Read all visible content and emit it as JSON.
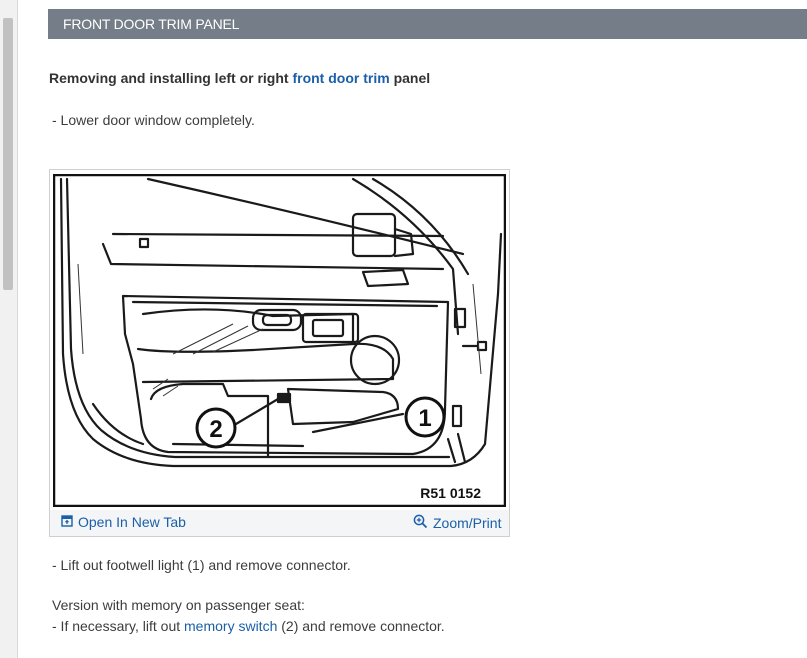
{
  "header": {
    "title": "FRONT DOOR TRIM PANEL"
  },
  "intro": {
    "prefix": "Removing and installing left or right ",
    "link": "front door trim",
    "suffix": " panel"
  },
  "steps": {
    "step1": "-  Lower door window completely.",
    "step2": "-  Lift out footwell light (1) and remove connector.",
    "note": "Version with memory on passenger seat:",
    "step3_prefix": "-  If necessary, lift out ",
    "step3_link": "memory switch",
    "step3_suffix": " (2) and remove connector."
  },
  "figure": {
    "callout_1": "1",
    "callout_2": "2",
    "ref_code": "R51 0152",
    "open_tab_label": "Open In New Tab",
    "zoom_label": "Zoom/Print",
    "open_tab_icon": "open-new-tab-icon",
    "zoom_icon": "zoom-in-icon"
  },
  "colors": {
    "header_bg": "#747d88",
    "link": "#1a5fa8"
  }
}
